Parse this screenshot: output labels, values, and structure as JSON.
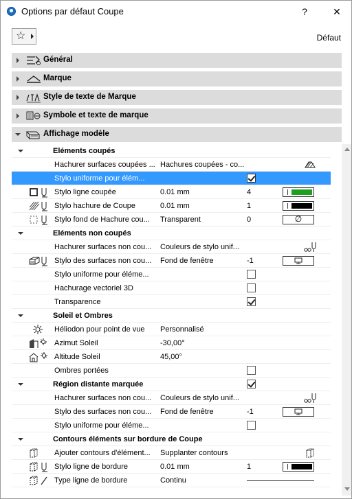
{
  "window": {
    "title": "Options par défaut Coupe",
    "help_label": "?",
    "close_label": "X"
  },
  "toolbar": {
    "favorites_icon": "star-icon",
    "default_label": "Défaut"
  },
  "panels": [
    {
      "label": "Général",
      "icon": "general-settings-icon",
      "expanded": false
    },
    {
      "label": "Marque",
      "icon": "marker-icon",
      "expanded": false
    },
    {
      "label": "Style de texte de Marque",
      "icon": "text-style-icon",
      "expanded": false
    },
    {
      "label": "Symbole et texte de marque",
      "icon": "symbol-text-icon",
      "expanded": false
    },
    {
      "label": "Affichage modèle",
      "icon": "model-display-icon",
      "expanded": true
    }
  ],
  "groups": [
    {
      "title": "Eléments coupés",
      "rows": [
        {
          "label": "Hachurer surfaces coupées ...",
          "value": "Hachures coupées - co..."
        },
        {
          "label": "Stylo uniforme pour élém...",
          "checked": true,
          "selected": true
        },
        {
          "label": "Stylo ligne coupée",
          "value": "0.01 mm",
          "num": "4",
          "swatch_color": "#1ea01e"
        },
        {
          "label": "Stylo hachure de Coupe",
          "value": "0.01 mm",
          "num": "1",
          "swatch_color": "#000000"
        },
        {
          "label": "Stylo fond de Hachure cou...",
          "value": "Transparent",
          "num": "0",
          "swatch_symbol": "∅"
        }
      ]
    },
    {
      "title": "Eléments non coupés",
      "rows": [
        {
          "label": "Hachurer surfaces non cou...",
          "value": "Couleurs de stylo unif..."
        },
        {
          "label": "Stylo des surfaces non cou...",
          "value": "Fond de fenêtre",
          "num": "-1"
        },
        {
          "label": "Stylo uniforme pour éléme...",
          "checked": false
        },
        {
          "label": "Hachurage vectoriel 3D",
          "checked": false
        },
        {
          "label": "Transparence",
          "checked": true
        }
      ]
    },
    {
      "title": "Soleil et Ombres",
      "rows": [
        {
          "label": "Héliodon pour point de vue",
          "value": "Personnalisé"
        },
        {
          "label": "Azimut Soleil",
          "value": "-30,00°"
        },
        {
          "label": "Altitude Soleil",
          "value": "45,00°"
        },
        {
          "label": "Ombres portées",
          "checked": false
        }
      ]
    },
    {
      "title": "Région distante marquée",
      "group_checked": true,
      "rows": [
        {
          "label": "Hachurer surfaces non cou...",
          "value": "Couleurs de stylo unif..."
        },
        {
          "label": "Stylo des surfaces non cou...",
          "value": "Fond de fenêtre",
          "num": "-1"
        },
        {
          "label": "Stylo uniforme pour éléme...",
          "checked": false
        }
      ]
    },
    {
      "title": "Contours éléments sur bordure de Coupe",
      "rows": [
        {
          "label": "Ajouter contours d'élément...",
          "value": "Supplanter contours"
        },
        {
          "label": "Stylo ligne de bordure",
          "value": "0.01 mm",
          "num": "1",
          "swatch_color": "#000000"
        },
        {
          "label": "Type ligne de bordure",
          "value": "Continu"
        }
      ]
    }
  ]
}
